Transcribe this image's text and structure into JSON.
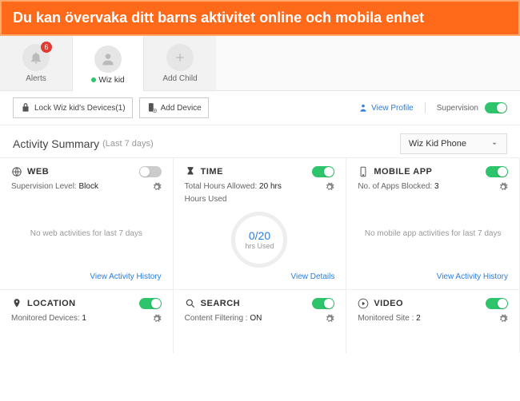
{
  "banner": {
    "text": "Du kan övervaka ditt barns aktivitet online och mobila enhet"
  },
  "tabs": {
    "alerts": {
      "label": "Alerts",
      "badge": "6"
    },
    "child": {
      "label": "Wiz kid"
    },
    "add": {
      "label": "Add Child"
    }
  },
  "toolbar": {
    "lock": "Lock Wiz kid's Devices(1)",
    "addDevice": "Add Device",
    "viewProfile": "View Profile",
    "supervision": "Supervision"
  },
  "summary": {
    "title": "Activity Summary",
    "sub": "(Last 7 days)",
    "device": "Wiz Kid Phone"
  },
  "cards": {
    "web": {
      "title": "WEB",
      "subLabel": "Supervision Level: ",
      "subValue": "Block",
      "empty": "No web activities for last 7 days",
      "footer": "View Activity History"
    },
    "time": {
      "title": "TIME",
      "subLabel": "Total Hours Allowed: ",
      "subValue": "20 hrs",
      "sub2": "Hours Used",
      "gaugeVal": "0/20",
      "gaugeLbl": "hrs Used",
      "footer": "View Details"
    },
    "mobile": {
      "title": "MOBILE APP",
      "subLabel": "No. of Apps Blocked: ",
      "subValue": "3",
      "empty": "No mobile app activities for last 7 days",
      "footer": "View Activity History"
    },
    "location": {
      "title": "LOCATION",
      "subLabel": "Monitored Devices: ",
      "subValue": "1"
    },
    "search": {
      "title": "SEARCH",
      "subLabel": "Content Filtering : ",
      "subValue": "ON"
    },
    "video": {
      "title": "VIDEO",
      "subLabel": "Monitored Site : ",
      "subValue": "2"
    }
  }
}
